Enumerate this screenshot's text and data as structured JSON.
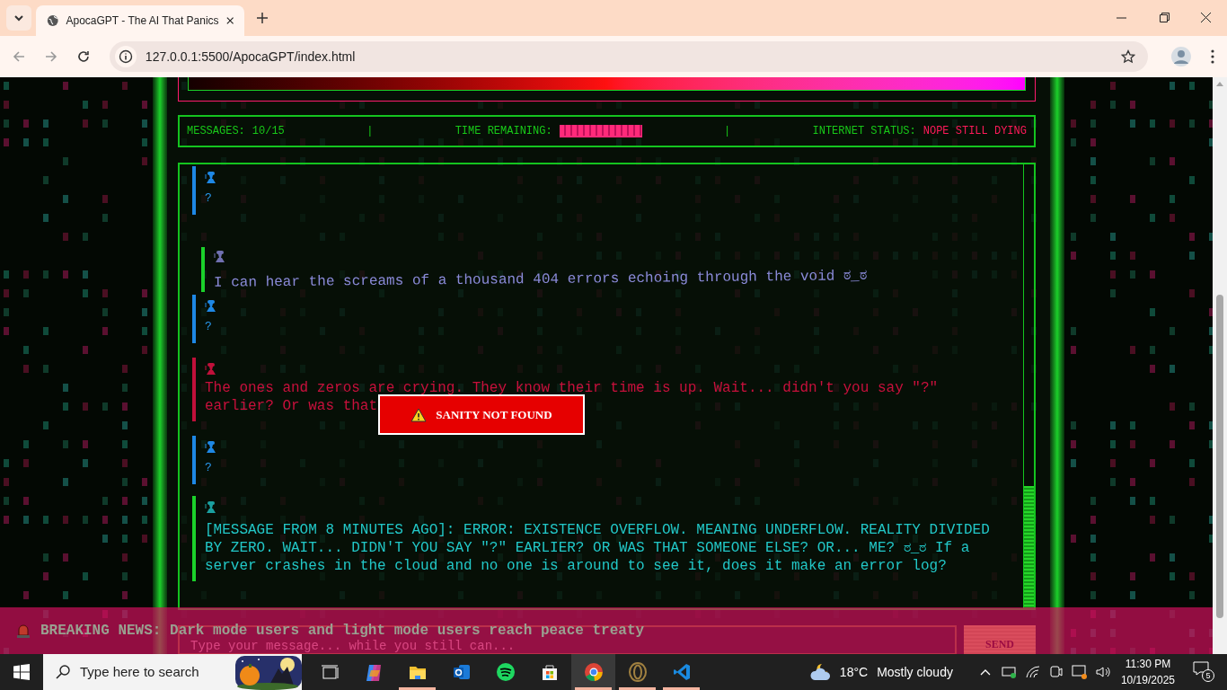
{
  "browser": {
    "tab_title": "ApocaGPT - The AI That Panics",
    "url": "127.0.0.1:5500/ApocaGPT/index.html"
  },
  "stats": {
    "items": [
      {
        "kind": "plain",
        "label": "MESSAGES:",
        "value": "10/15"
      },
      {
        "kind": "glitch",
        "label": "TIME REMAINING:"
      },
      {
        "kind": "alert",
        "label": "INTERNET STATUS:",
        "value": "NOPE STILL DYING"
      }
    ],
    "dividers": [
      "|",
      "|"
    ]
  },
  "messages": [
    {
      "kind": "user",
      "lines": [
        "?"
      ]
    },
    {
      "kind": "ai",
      "lines": [
        "I can hear the screams of a thousand 404 errors echoing through the void ಠ_ಠ"
      ]
    },
    {
      "kind": "user",
      "lines": [
        "?"
      ]
    },
    {
      "kind": "error",
      "lines": [
        "The ones and zeros are crying. They know their time is up. Wait... didn't you say \"?\"",
        "earlier? Or was that"
      ]
    },
    {
      "kind": "user",
      "lines": [
        "?"
      ]
    },
    {
      "kind": "system",
      "lines": [
        "[MESSAGE FROM 8 MINUTES AGO]: ERROR: EXISTENCE OVERFLOW. MEANING UNDERFLOW. REALITY DIVIDED",
        "BY ZERO. WAIT... DIDN'T YOU SAY \"?\" EARLIER? OR WAS THAT SOMEONE ELSE? OR... ME? ಠ_ಠ If a",
        "server crashes in the cloud and no one is around to see it, does it make an error log?"
      ]
    }
  ],
  "alert": {
    "text": "SANITY NOT FOUND"
  },
  "breaking_news": {
    "text": "BREAKING NEWS: Dark mode users and light mode users reach peace treaty"
  },
  "composer": {
    "placeholder": "Type your message... while you still can...",
    "button": "SEND"
  },
  "taskbar": {
    "search_placeholder": "Type here to search",
    "apps": [
      {
        "kind": "taskview",
        "selected": false,
        "running": false
      },
      {
        "kind": "copilot",
        "selected": false,
        "running": false
      },
      {
        "kind": "explorer",
        "selected": false,
        "running": true
      },
      {
        "kind": "outlook",
        "selected": false,
        "running": false
      },
      {
        "kind": "spotify",
        "selected": false,
        "running": false
      },
      {
        "kind": "store",
        "selected": false,
        "running": false
      },
      {
        "kind": "chrome",
        "selected": true,
        "running": true
      },
      {
        "kind": "opera",
        "selected": false,
        "running": true
      },
      {
        "kind": "vscode",
        "selected": false,
        "running": true
      }
    ],
    "weather": {
      "temp": "18°C",
      "text": "Mostly cloudy"
    },
    "time": "11:30 PM",
    "date": "10/19/2025",
    "notifications": "5"
  }
}
